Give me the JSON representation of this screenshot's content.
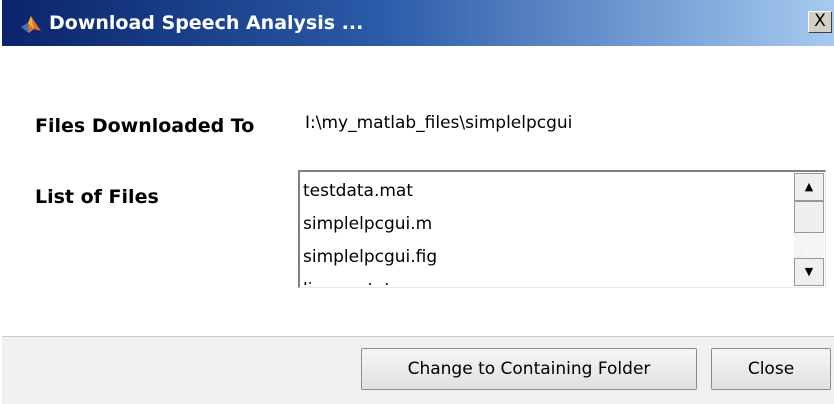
{
  "window": {
    "title": "Download Speech Analysis ...",
    "close_glyph": "X",
    "icon": "matlab-logo-icon"
  },
  "form": {
    "files_downloaded_label": "Files Downloaded To",
    "files_downloaded_value": "I:\\my_matlab_files\\simplelpcgui",
    "list_label": "List of Files",
    "files": [
      "testdata.mat",
      "simplelpcgui.m",
      "simplelpcgui.fig",
      "license.txt"
    ]
  },
  "scrollbar": {
    "up_glyph": "▲",
    "down_glyph": "▼"
  },
  "buttons": {
    "change_folder": "Change to Containing Folder",
    "close": "Close"
  },
  "colors": {
    "title_gradient_start": "#0a246a",
    "title_gradient_end": "#a6caf0",
    "footer_bg": "#f0f0f0"
  }
}
